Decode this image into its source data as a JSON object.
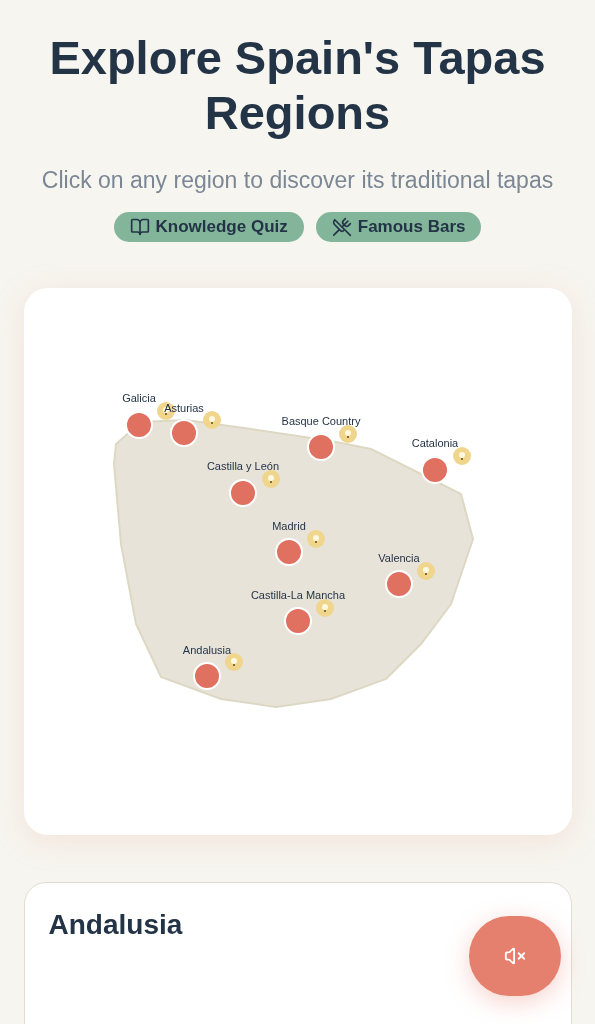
{
  "header": {
    "title": "Explore Spain's Tapas Regions",
    "subtitle": "Click on any region to discover its traditional tapas"
  },
  "buttons": [
    {
      "kind": "quiz",
      "label": "Knowledge Quiz"
    },
    {
      "kind": "bars",
      "label": "Famous Bars"
    }
  ],
  "map": {
    "regions": [
      {
        "name": "Galicia"
      },
      {
        "name": "Asturias"
      },
      {
        "name": "Basque Country"
      },
      {
        "name": "Catalonia"
      },
      {
        "name": "Castilla y León"
      },
      {
        "name": "Madrid"
      },
      {
        "name": "Valencia"
      },
      {
        "name": "Castilla-La Mancha"
      },
      {
        "name": "Andalusia"
      }
    ]
  },
  "detail": {
    "title": "Andalusia"
  },
  "sound": {
    "muted": true
  }
}
